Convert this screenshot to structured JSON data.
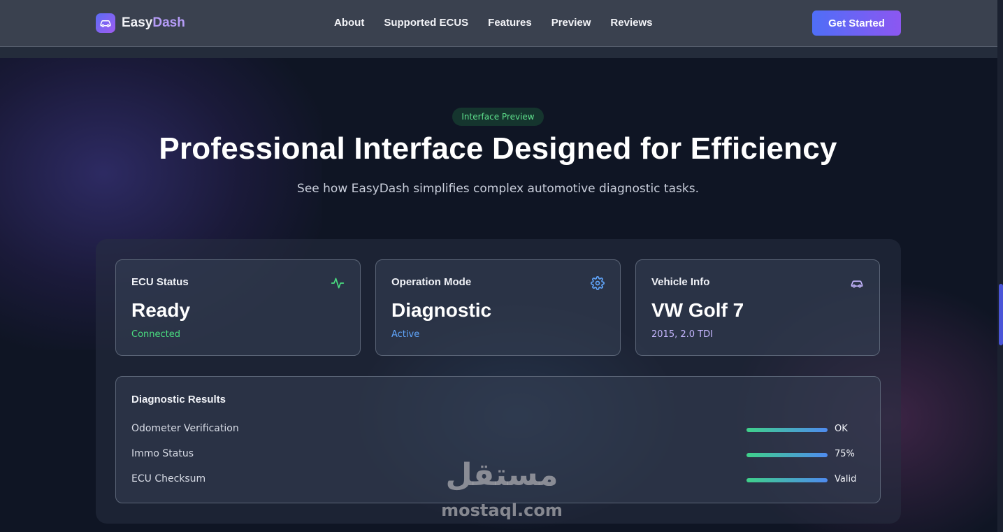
{
  "navbar": {
    "brand_part1": "Easy",
    "brand_part2": "Dash",
    "links": [
      "About",
      "Supported ECUS",
      "Features",
      "Preview",
      "Reviews"
    ],
    "cta_label": "Get Started"
  },
  "hero": {
    "pill": "Interface Preview",
    "title": "Professional Interface Designed for Efficiency",
    "subtitle": "See how EasyDash simplifies complex automotive diagnostic tasks."
  },
  "cards": [
    {
      "label": "ECU Status",
      "value": "Ready",
      "sub": "Connected",
      "sub_color": "#4ade80",
      "icon": "activity-icon"
    },
    {
      "label": "Operation Mode",
      "value": "Diagnostic",
      "sub": "Active",
      "sub_color": "#60a5fa",
      "icon": "gear-icon"
    },
    {
      "label": "Vehicle Info",
      "value": "VW Golf 7",
      "sub": "2015, 2.0 TDI",
      "sub_color": "#c4b5fd",
      "icon": "car-icon"
    }
  ],
  "results": {
    "title": "Diagnostic Results",
    "rows": [
      {
        "label": "Odometer Verification",
        "status": "OK"
      },
      {
        "label": "Immo Status",
        "status": "75%"
      },
      {
        "label": "ECU Checksum",
        "status": "Valid"
      }
    ]
  },
  "watermark": {
    "arabic": "مستقل",
    "latin": "mostaql.com"
  },
  "colors": {
    "accent_start": "#4f6ef7",
    "accent_end": "#8c57f1",
    "success": "#4ade80",
    "info": "#60a5fa"
  }
}
